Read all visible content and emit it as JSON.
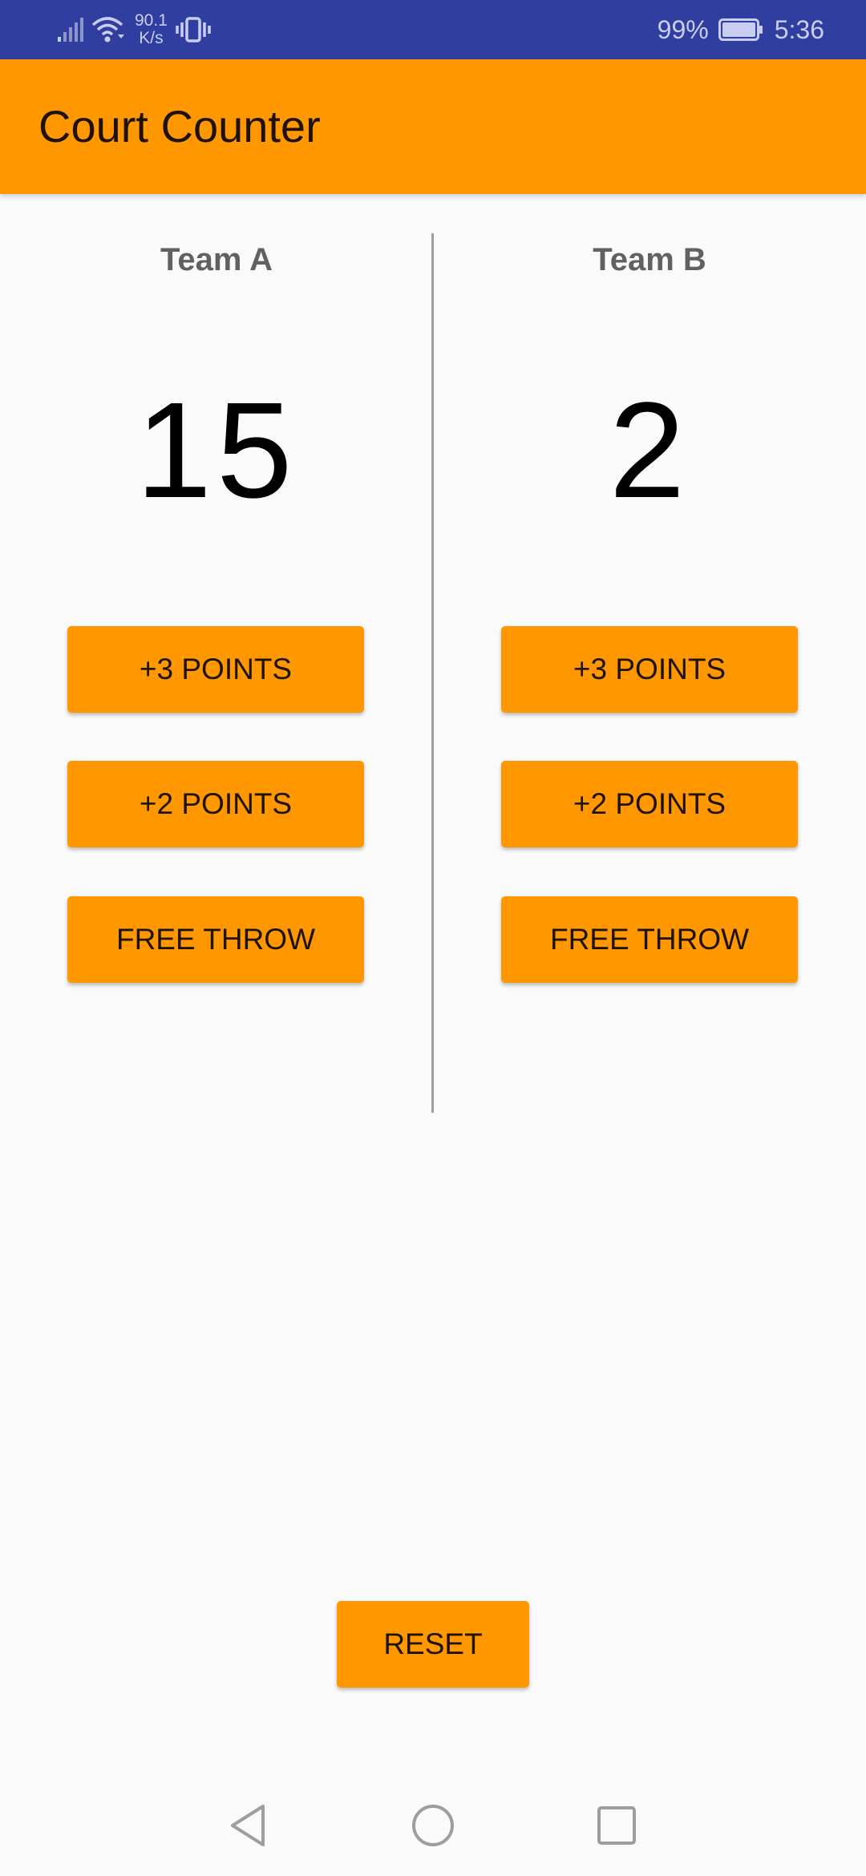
{
  "status_bar": {
    "net_speed_value": "90.1",
    "net_speed_unit": "K/s",
    "battery_percent": "99%",
    "time": "5:36",
    "icons": [
      "signal-icon",
      "wifi-icon",
      "vibrate-icon",
      "battery-icon"
    ]
  },
  "app_bar": {
    "title": "Court Counter"
  },
  "team_a": {
    "name": "Team A",
    "score": "15",
    "buttons": {
      "three": "+3 POINTS",
      "two": "+2 POINTS",
      "free": "FREE THROW"
    }
  },
  "team_b": {
    "name": "Team B",
    "score": "2",
    "buttons": {
      "three": "+3 POINTS",
      "two": "+2 POINTS",
      "free": "FREE THROW"
    }
  },
  "reset": {
    "label": "RESET"
  },
  "nav_bar": {
    "icons": [
      "back-icon",
      "home-icon",
      "recents-icon"
    ]
  },
  "colors": {
    "status_bar": "#303f9f",
    "accent": "#ff9800",
    "background": "#fafafa",
    "team_name": "#616161",
    "divider": "#9e9e9e"
  }
}
